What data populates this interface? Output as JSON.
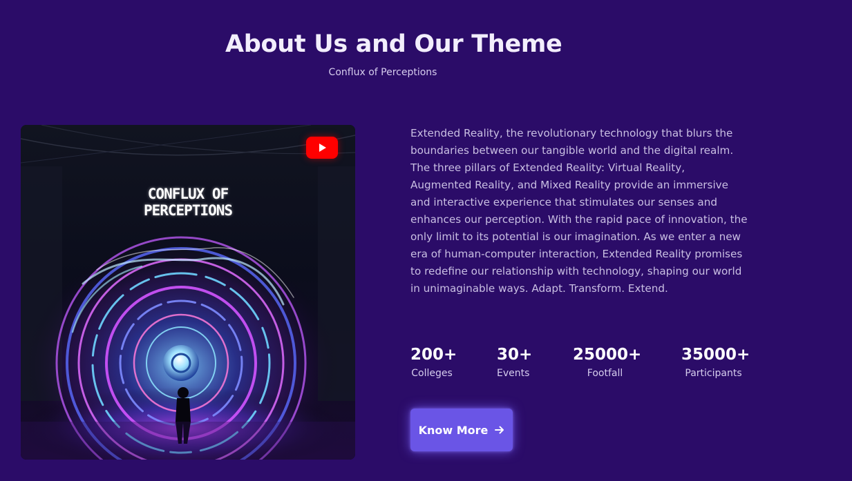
{
  "header": {
    "title": "About Us and Our Theme",
    "subtitle": "Conflux of Perceptions"
  },
  "video": {
    "poster_title": "CONFLUX OF\nPERCEPTIONS",
    "play_icon": "youtube-play-icon"
  },
  "about": {
    "text": "Extended Reality, the revolutionary technology that blurs the boundaries between our tangible world and the digital realm. The three pillars of Extended Reality: Virtual Reality, Augmented Reality, and Mixed Reality provide an immersive and interactive experience that stimulates our senses and enhances our perception. With the rapid pace of innovation, the only limit to its potential is our imagination. As we enter a new era of human-computer interaction, Extended Reality promises to redefine our relationship with technology, shaping our world in unimaginable ways. Adapt. Transform. Extend."
  },
  "stats": [
    {
      "value": "200+",
      "label": "Colleges"
    },
    {
      "value": "30+",
      "label": "Events"
    },
    {
      "value": "25000+",
      "label": "Footfall"
    },
    {
      "value": "35000+",
      "label": "Participants"
    }
  ],
  "cta": {
    "label": "Know More",
    "icon": "arrow-right-icon"
  },
  "colors": {
    "background": "#2b0c68",
    "button": "#6a55e6",
    "youtube_red": "#ff0000"
  }
}
